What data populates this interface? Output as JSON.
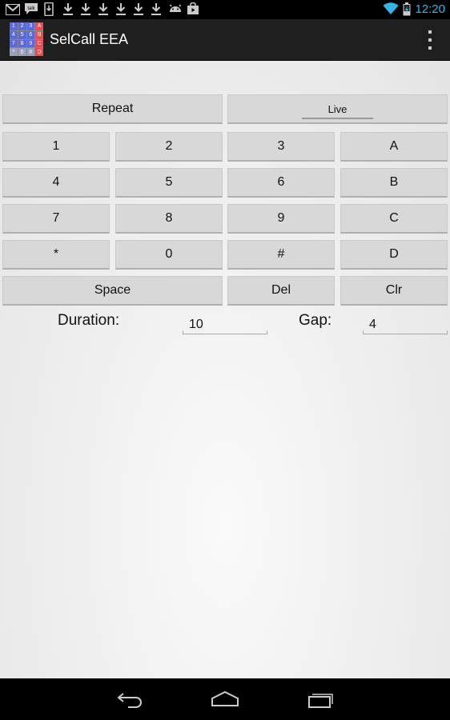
{
  "status_bar": {
    "time": "12:20",
    "talk_label": "talk",
    "left_icons": [
      "gmail-icon",
      "talk-icon",
      "phone-download-icon",
      "download-icon",
      "download-icon",
      "download-icon",
      "download-icon",
      "download-icon",
      "download-icon",
      "android-icon",
      "shopping-bag-icon"
    ],
    "right_icons": [
      "wifi-icon",
      "battery-charging-icon"
    ],
    "time_color": "#33b5e5"
  },
  "action_bar": {
    "title": "SelCall EEA",
    "app_icon_cells": [
      "1",
      "2",
      "3",
      "A",
      "4",
      "5",
      "6",
      "B",
      "7",
      "8",
      "9",
      "C",
      "*",
      "0",
      "#",
      "D"
    ]
  },
  "controls": {
    "repeat_label": "Repeat",
    "live_label": "Live",
    "keypad": [
      [
        "1",
        "2",
        "3",
        "A"
      ],
      [
        "4",
        "5",
        "6",
        "B"
      ],
      [
        "7",
        "8",
        "9",
        "C"
      ],
      [
        "*",
        "0",
        "#",
        "D"
      ]
    ],
    "space_label": "Space",
    "del_label": "Del",
    "clr_label": "Clr",
    "duration_label": "Duration:",
    "duration_value": "10",
    "gap_label": "Gap:",
    "gap_value": "4"
  },
  "nav_bar": {
    "icons": [
      "back-icon",
      "home-icon",
      "recent-apps-icon"
    ]
  }
}
